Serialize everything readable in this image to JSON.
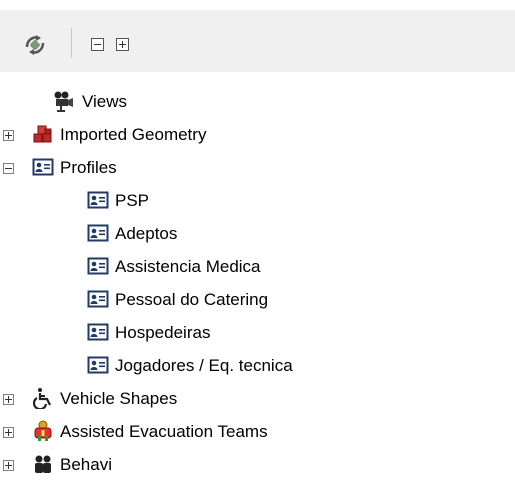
{
  "toolbar": {
    "sync_icon": "sync-icon",
    "collapse_all_icon": "collapse-all-icon",
    "expand_all_icon": "expand-all-icon"
  },
  "tree": {
    "views": {
      "label": "Views",
      "icon": "camera-icon"
    },
    "imported_geometry": {
      "label": "Imported Geometry",
      "icon": "blocks-icon",
      "state": "collapsed"
    },
    "profiles": {
      "label": "Profiles",
      "icon": "profile-card-icon",
      "state": "expanded",
      "children": [
        {
          "label": "PSP"
        },
        {
          "label": "Adeptos"
        },
        {
          "label": "Assistencia Medica"
        },
        {
          "label": "Pessoal do Catering"
        },
        {
          "label": "Hospedeiras"
        },
        {
          "label": "Jogadores / Eq. tecnica"
        }
      ]
    },
    "vehicle_shapes": {
      "label": "Vehicle Shapes",
      "icon": "wheelchair-icon",
      "state": "collapsed"
    },
    "assisted_evacuation_teams": {
      "label": "Assisted Evacuation Teams",
      "icon": "team-icon",
      "state": "collapsed"
    },
    "partial_next": {
      "label": "Behavi",
      "icon": "people-icon",
      "state": "collapsed"
    }
  }
}
